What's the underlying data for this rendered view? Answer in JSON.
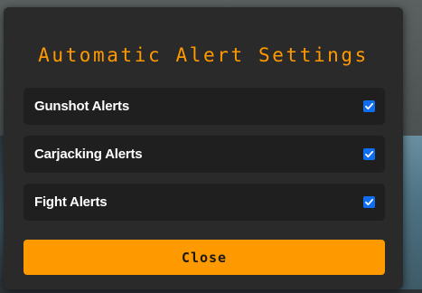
{
  "modal": {
    "title": "Automatic Alert Settings",
    "options": [
      {
        "label": "Gunshot Alerts",
        "checked": true
      },
      {
        "label": "Carjacking Alerts",
        "checked": true
      },
      {
        "label": "Fight Alerts",
        "checked": true
      }
    ],
    "close_label": "Close"
  },
  "colors": {
    "accent": "#ff9900",
    "modal_bg": "#2a2a2a",
    "row_bg": "#1f1f1f",
    "checkbox": "#0f6ef0"
  }
}
